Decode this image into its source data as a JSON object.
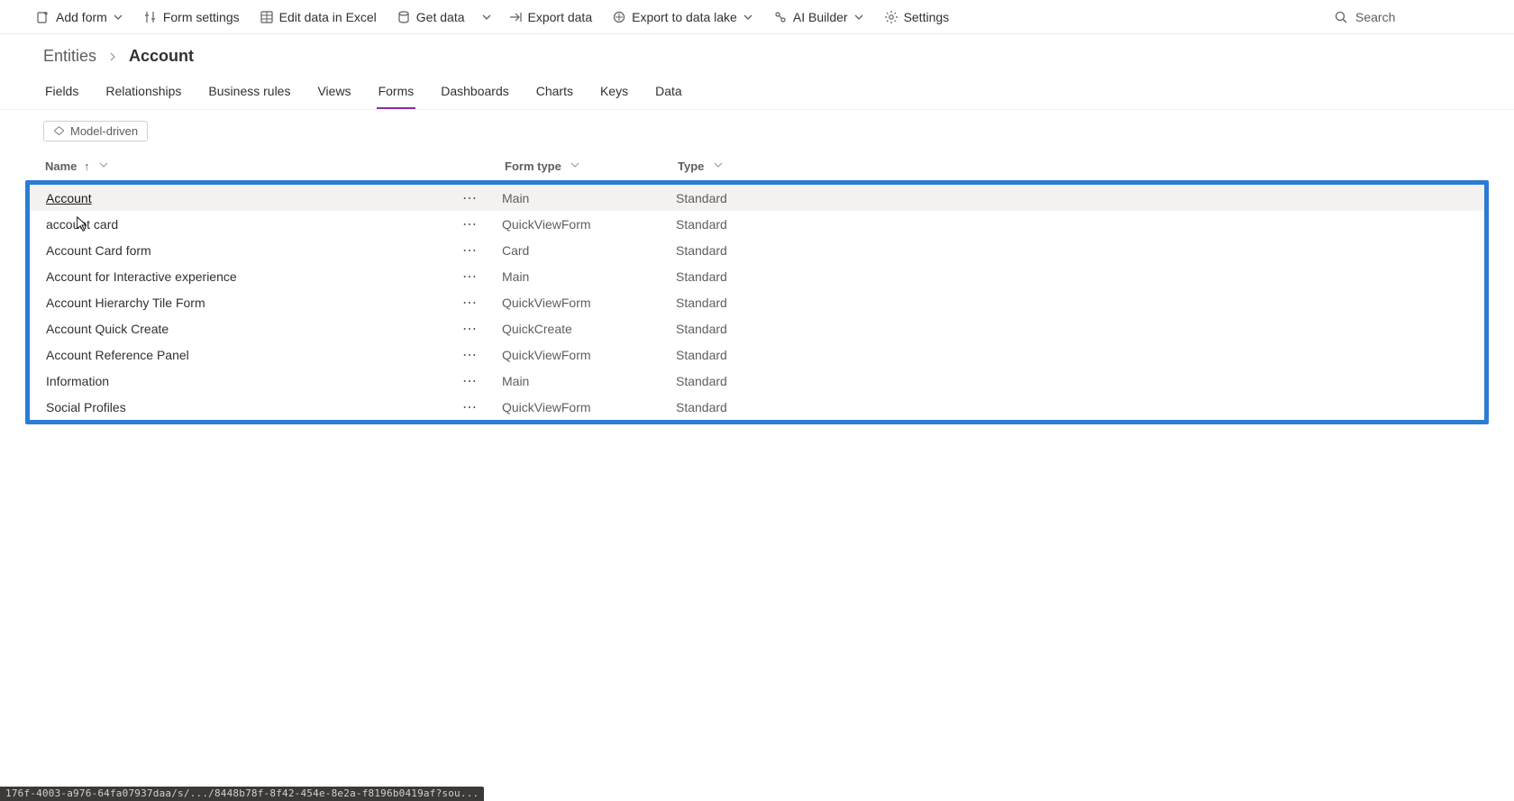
{
  "commands": {
    "add_form": "Add form",
    "form_settings": "Form settings",
    "edit_excel": "Edit data in Excel",
    "get_data": "Get data",
    "export_data": "Export data",
    "export_lake": "Export to data lake",
    "ai_builder": "AI Builder",
    "settings": "Settings",
    "search_placeholder": "Search"
  },
  "breadcrumb": {
    "root": "Entities",
    "current": "Account"
  },
  "tabs": [
    "Fields",
    "Relationships",
    "Business rules",
    "Views",
    "Forms",
    "Dashboards",
    "Charts",
    "Keys",
    "Data"
  ],
  "active_tab": "Forms",
  "filter_label": "Model-driven",
  "columns": {
    "name": "Name",
    "form_type": "Form type",
    "type": "Type"
  },
  "rows": [
    {
      "name": "Account",
      "form_type": "Main",
      "type": "Standard",
      "hover": true,
      "link": true
    },
    {
      "name": "account card",
      "form_type": "QuickViewForm",
      "type": "Standard"
    },
    {
      "name": "Account Card form",
      "form_type": "Card",
      "type": "Standard"
    },
    {
      "name": "Account for Interactive experience",
      "form_type": "Main",
      "type": "Standard"
    },
    {
      "name": "Account Hierarchy Tile Form",
      "form_type": "QuickViewForm",
      "type": "Standard"
    },
    {
      "name": "Account Quick Create",
      "form_type": "QuickCreate",
      "type": "Standard"
    },
    {
      "name": "Account Reference Panel",
      "form_type": "QuickViewForm",
      "type": "Standard"
    },
    {
      "name": "Information",
      "form_type": "Main",
      "type": "Standard"
    },
    {
      "name": "Social Profiles",
      "form_type": "QuickViewForm",
      "type": "Standard"
    }
  ],
  "status_text": "176f-4003-a976-64fa07937daa/s/.../8448b78f-8f42-454e-8e2a-f8196b0419af?sou..."
}
